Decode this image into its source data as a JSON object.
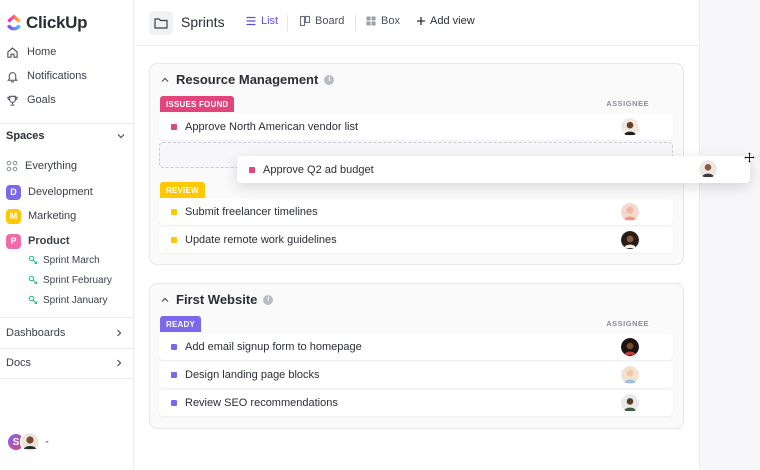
{
  "app": {
    "name": "ClickUp"
  },
  "sidebar": {
    "nav": [
      {
        "label": "Home",
        "icon": "home-icon"
      },
      {
        "label": "Notifications",
        "icon": "bell-icon"
      },
      {
        "label": "Goals",
        "icon": "trophy-icon"
      }
    ],
    "spaces_label": "Spaces",
    "everything_label": "Everything",
    "spaces": [
      {
        "badge": "D",
        "label": "Development",
        "color": "#7b68ee"
      },
      {
        "badge": "M",
        "label": "Marketing",
        "color": "#ffc800"
      },
      {
        "badge": "P",
        "label": "Product",
        "color": "#f06ba8"
      }
    ],
    "sprints": [
      "Sprint  March",
      "Sprint  February",
      "Sprint January"
    ],
    "dashboards_label": "Dashboards",
    "docs_label": "Docs",
    "user_initial": "S"
  },
  "topbar": {
    "title": "Sprints",
    "views": {
      "list": "List",
      "board": "Board",
      "box": "Box",
      "add": "Add view"
    }
  },
  "groups": [
    {
      "title": "Resource Management",
      "assignee_header": "ASSIGNEE",
      "statuses": [
        {
          "label": "ISSUES FOUND",
          "color": "#e2447c",
          "tasks": [
            "Approve North American vendor list"
          ]
        },
        {
          "label": "REVIEW",
          "color": "#ffc800",
          "tasks": [
            "Submit freelancer timelines",
            "Update remote work guidelines"
          ]
        }
      ]
    },
    {
      "title": "First Website",
      "assignee_header": "ASSIGNEE",
      "statuses": [
        {
          "label": "READY",
          "color": "#7b68ee",
          "tasks": [
            "Add email signup form to homepage",
            "Design landing page blocks",
            "Review SEO recommendations"
          ]
        }
      ]
    }
  ],
  "dragged_task": {
    "label": "Approve Q2 ad budget",
    "color": "#e2447c"
  }
}
